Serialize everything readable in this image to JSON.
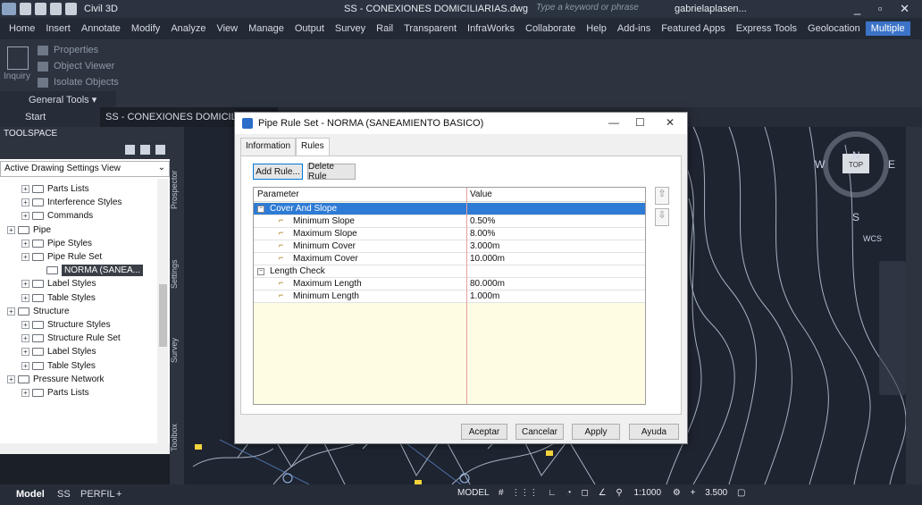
{
  "titlebar": {
    "workspace": "Civil 3D",
    "document": "SS - CONEXIONES DOMICILIARIAS.dwg",
    "search_placeholder": "Type a keyword or phrase",
    "user": "gabrielaplasen..."
  },
  "menu": [
    "Home",
    "Insert",
    "Annotate",
    "Modify",
    "Analyze",
    "View",
    "Manage",
    "Output",
    "Survey",
    "Rail",
    "Transparent",
    "InfraWorks",
    "Collaborate",
    "Help",
    "Add-ins",
    "Featured Apps",
    "Express Tools",
    "Geolocation",
    "Multiple"
  ],
  "menu_active": "Multiple",
  "ribbon": {
    "items": [
      "Properties",
      "Object Viewer",
      "Isolate Objects"
    ],
    "inquiry": "Inquiry",
    "panel": "General Tools ▾"
  },
  "doctabs": {
    "start": "Start",
    "active": "SS - CONEXIONES DOMICILIARIAS*"
  },
  "toolspace": {
    "title": "TOOLSPACE",
    "view": "Active Drawing Settings View",
    "side_tabs": [
      "Prospector",
      "Settings",
      "Survey",
      "Toolbox"
    ],
    "tree": [
      {
        "label": "Parts Lists",
        "level": 1
      },
      {
        "label": "Interference Styles",
        "level": 1
      },
      {
        "label": "Commands",
        "level": 1
      },
      {
        "label": "Pipe",
        "level": 0
      },
      {
        "label": "Pipe Styles",
        "level": 1
      },
      {
        "label": "Pipe Rule Set",
        "level": 1
      },
      {
        "label": "NORMA (SANEA...",
        "level": 2,
        "selected": true
      },
      {
        "label": "Label Styles",
        "level": 1
      },
      {
        "label": "Table Styles",
        "level": 1
      },
      {
        "label": "Structure",
        "level": 0
      },
      {
        "label": "Structure Styles",
        "level": 1
      },
      {
        "label": "Structure Rule Set",
        "level": 1
      },
      {
        "label": "Label Styles",
        "level": 1
      },
      {
        "label": "Table Styles",
        "level": 1
      },
      {
        "label": "Pressure Network",
        "level": 0
      },
      {
        "label": "Parts Lists",
        "level": 1
      }
    ]
  },
  "dialog": {
    "title": "Pipe Rule Set - NORMA (SANEAMIENTO BASICO)",
    "tabs": [
      "Information",
      "Rules"
    ],
    "active_tab": "Rules",
    "add_rule": "Add Rule...",
    "delete_rule": "Delete Rule",
    "col_parameter": "Parameter",
    "col_value": "Value",
    "groups": [
      {
        "name": "Cover And Slope",
        "selected": true,
        "rows": [
          {
            "parameter": "Minimum Slope",
            "value": "0.50%"
          },
          {
            "parameter": "Maximum Slope",
            "value": "8.00%"
          },
          {
            "parameter": "Minimum Cover",
            "value": "3.000m"
          },
          {
            "parameter": "Maximum Cover",
            "value": "10.000m"
          }
        ]
      },
      {
        "name": "Length Check",
        "selected": false,
        "rows": [
          {
            "parameter": "Maximum Length",
            "value": "80.000m"
          },
          {
            "parameter": "Minimum Length",
            "value": "1.000m"
          }
        ]
      }
    ],
    "buttons": {
      "ok": "Aceptar",
      "cancel": "Cancelar",
      "apply": "Apply",
      "help": "Ayuda"
    }
  },
  "viewcube": {
    "n": "N",
    "s": "S",
    "e": "E",
    "w": "W",
    "top": "TOP",
    "wcs": "WCS"
  },
  "layout_tabs": [
    "Model",
    "SS",
    "PERFIL",
    "+"
  ],
  "statusbar": {
    "model": "MODEL",
    "scale": "1:1000",
    "value": "3.500"
  },
  "colors": {
    "accent": "#2e7bd6",
    "drawing_bg": "#1e2430",
    "contour": "#c9d3e6",
    "pipe": "#f2d33c"
  }
}
